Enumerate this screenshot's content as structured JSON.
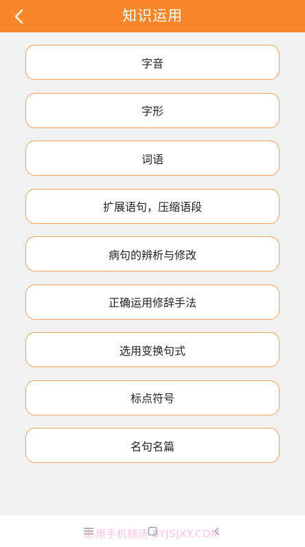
{
  "header": {
    "title": "知识运用",
    "back_icon": "chevron-left-icon"
  },
  "menu": {
    "items": [
      {
        "label": "字音"
      },
      {
        "label": "字形"
      },
      {
        "label": "词语"
      },
      {
        "label": "扩展语句，压缩语段"
      },
      {
        "label": "病句的辨析与修改"
      },
      {
        "label": "正确运用修辞手法"
      },
      {
        "label": "选用变换句式"
      },
      {
        "label": "标点符号"
      },
      {
        "label": "名句名篇"
      }
    ]
  },
  "navbar": {
    "menu_icon": "hamburger-menu-icon",
    "home_icon": "square-home-icon",
    "back_icon": "chevron-left-back-icon"
  },
  "watermark": {
    "text": "必用手机精选 BYJSJXY.COM"
  },
  "colors": {
    "accent": "#f7872a",
    "button_border": "#f0a060",
    "background": "#f2f2f2"
  }
}
